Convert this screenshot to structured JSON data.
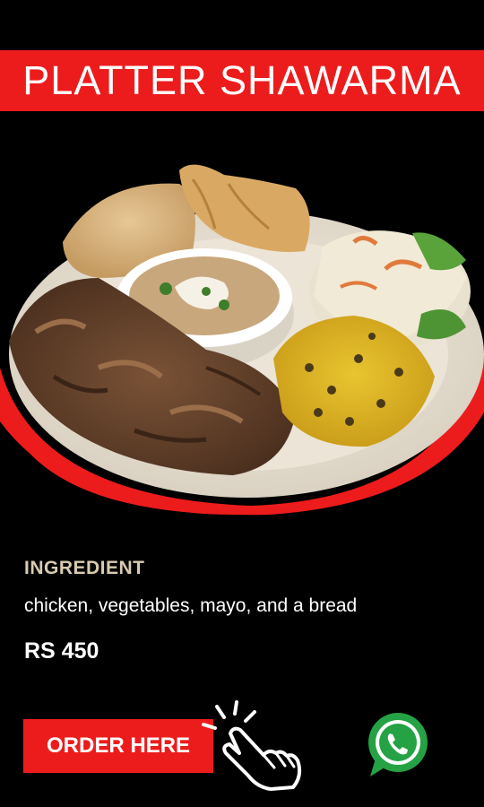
{
  "title": "PLATTER SHAWARMA",
  "image": {
    "alt": "shawarma-platter-photo",
    "accent_color": "#ed1c1c"
  },
  "ingredients": {
    "heading": "INGREDIENT",
    "text": "chicken, vegetables, mayo, and a bread"
  },
  "price": "RS 450",
  "cta": {
    "order_label": "ORDER HERE",
    "pointer_icon": "hand-pointer-icon",
    "whatsapp_icon": "whatsapp-icon"
  },
  "colors": {
    "background": "#000000",
    "brand_red": "#ed1c1c",
    "heading_beige": "#d9cbb0",
    "whatsapp_green": "#25a244"
  }
}
